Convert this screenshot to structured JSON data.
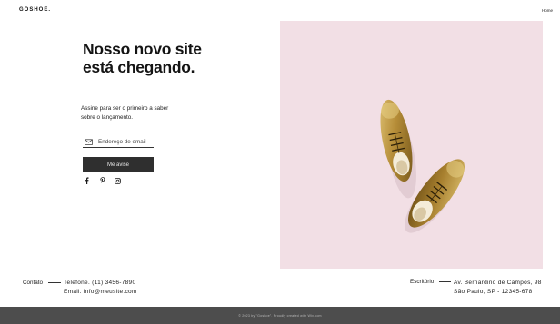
{
  "header": {
    "logo": "GOSHOE.",
    "nav_home": "Home"
  },
  "hero": {
    "title": "Nosso novo site está chegando.",
    "subtitle": "Assine para ser o primeiro a saber sobre o lançamento.",
    "email_placeholder": "Endereço de email",
    "submit_label": "Me avise"
  },
  "socials": [
    {
      "icon": "facebook-icon"
    },
    {
      "icon": "pinterest-icon"
    },
    {
      "icon": "instagram-icon"
    }
  ],
  "image": {
    "background_color": "#f2dfe5",
    "subject": "gold-shoes"
  },
  "contact": {
    "label": "Contato",
    "phone": "Telefone. (11) 3456-7890",
    "email": "Email. info@meusite.com"
  },
  "office": {
    "label": "Escritório",
    "address_line1": "Av. Bernardino de Campos, 98",
    "address_line2": "São Paulo, SP - 12345-678"
  },
  "footer": {
    "text": "© 2023 by \"Goshoe\". Proudly created with Wix.com",
    "background_color": "#4d4d4d"
  }
}
